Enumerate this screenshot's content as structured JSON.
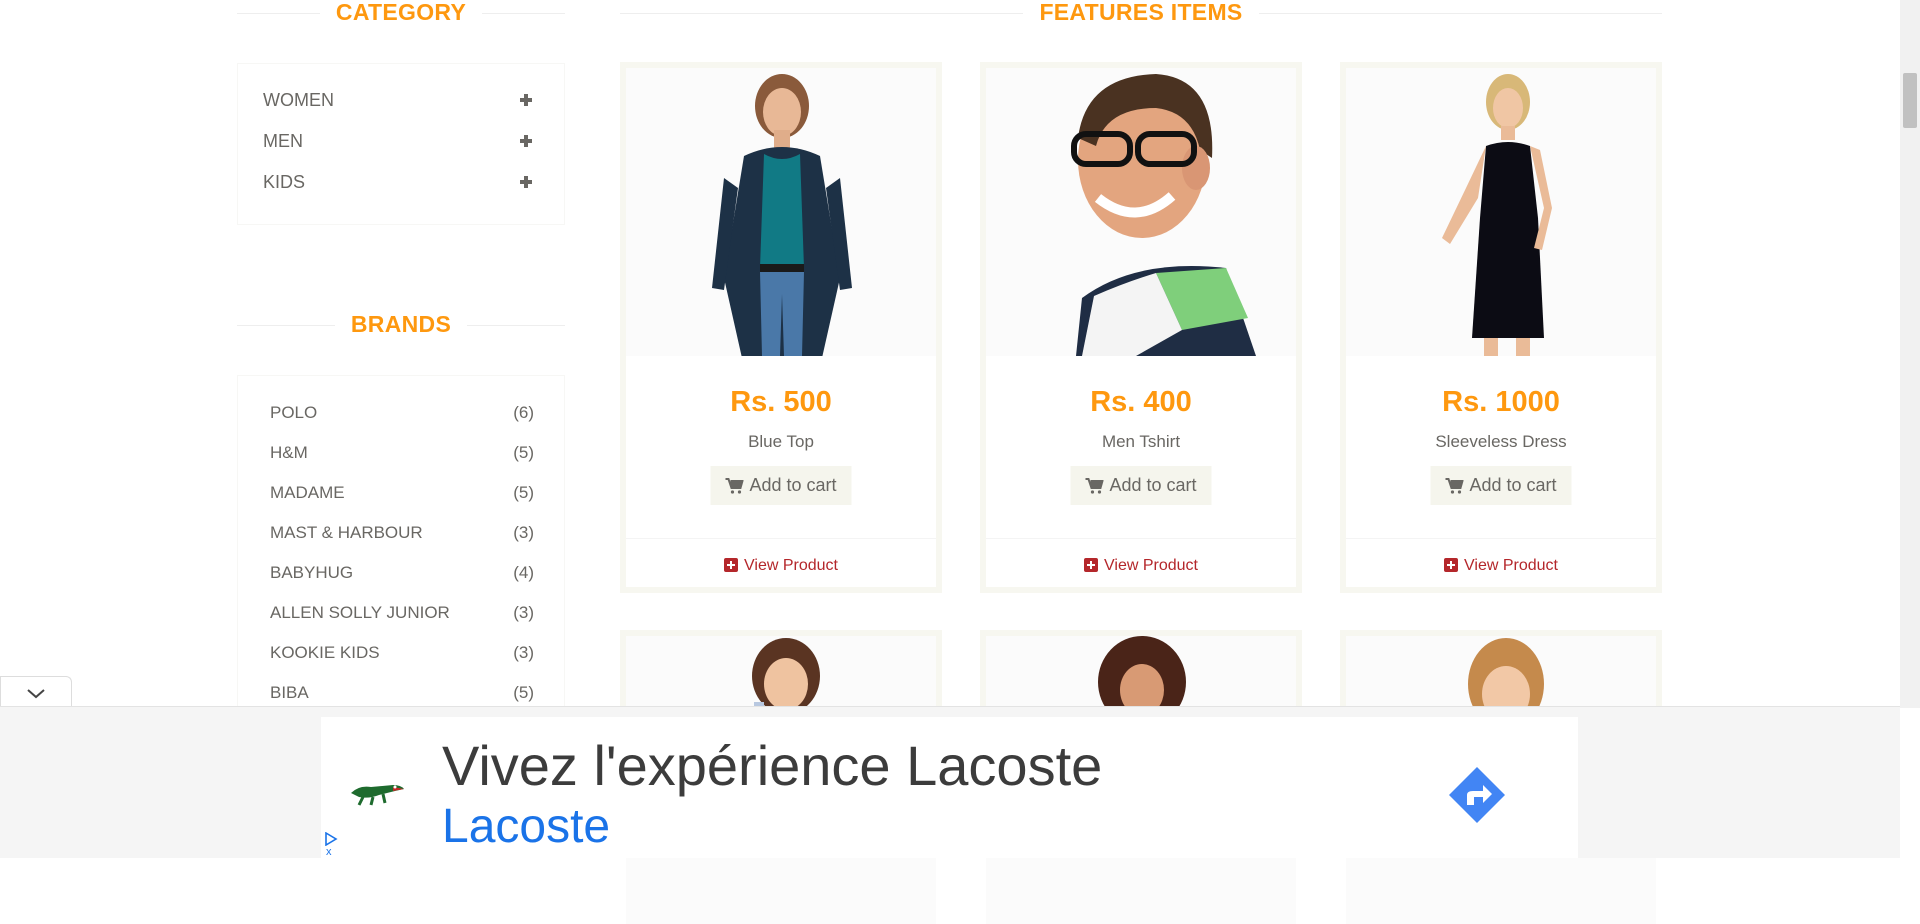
{
  "sidebar": {
    "category_title": "CATEGORY",
    "categories": [
      {
        "label": "WOMEN"
      },
      {
        "label": "MEN"
      },
      {
        "label": "KIDS"
      }
    ],
    "brands_title": "BRANDS",
    "brands": [
      {
        "name": "POLO",
        "count": "(6)"
      },
      {
        "name": "H&M",
        "count": "(5)"
      },
      {
        "name": "MADAME",
        "count": "(5)"
      },
      {
        "name": "MAST & HARBOUR",
        "count": "(3)"
      },
      {
        "name": "BABYHUG",
        "count": "(4)"
      },
      {
        "name": "ALLEN SOLLY JUNIOR",
        "count": "(3)"
      },
      {
        "name": "KOOKIE KIDS",
        "count": "(3)"
      },
      {
        "name": "BIBA",
        "count": "(5)"
      }
    ]
  },
  "features": {
    "title": "FEATURES ITEMS",
    "products": [
      {
        "price": "Rs. 500",
        "name": "Blue Top",
        "cart_label": "Add to cart",
        "view_label": "View Product"
      },
      {
        "price": "Rs. 400",
        "name": "Men Tshirt",
        "cart_label": "Add to cart",
        "view_label": "View Product"
      },
      {
        "price": "Rs. 1000",
        "name": "Sleeveless Dress",
        "cart_label": "Add to cart",
        "view_label": "View Product"
      }
    ]
  },
  "ad": {
    "headline": "Vivez l'expérience Lacoste",
    "advertiser": "Lacoste",
    "close_mark": "x"
  },
  "colors": {
    "accent": "#FE980F",
    "text": "#696763",
    "view_link": "#B4272B",
    "ad_link": "#1a73e8"
  }
}
